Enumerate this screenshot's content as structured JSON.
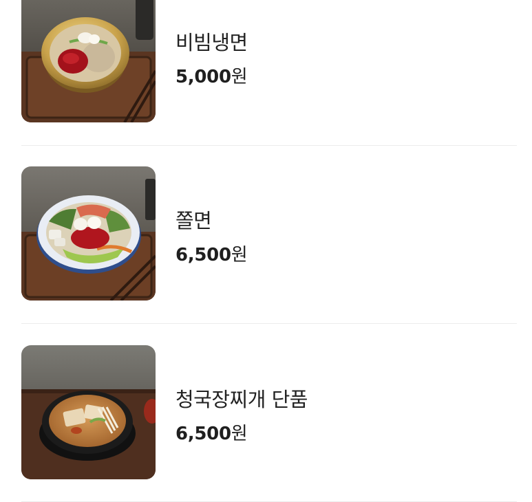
{
  "menu": {
    "items": [
      {
        "name": "비빔냉면",
        "price": "5,000",
        "unit": "원",
        "image": "bibim-naengmyeon-photo"
      },
      {
        "name": "쫄면",
        "price": "6,500",
        "unit": "원",
        "image": "jjolmyeon-photo"
      },
      {
        "name": "청국장찌개 단품",
        "price": "6,500",
        "unit": "원",
        "image": "cheonggukjang-stew-photo"
      }
    ]
  }
}
